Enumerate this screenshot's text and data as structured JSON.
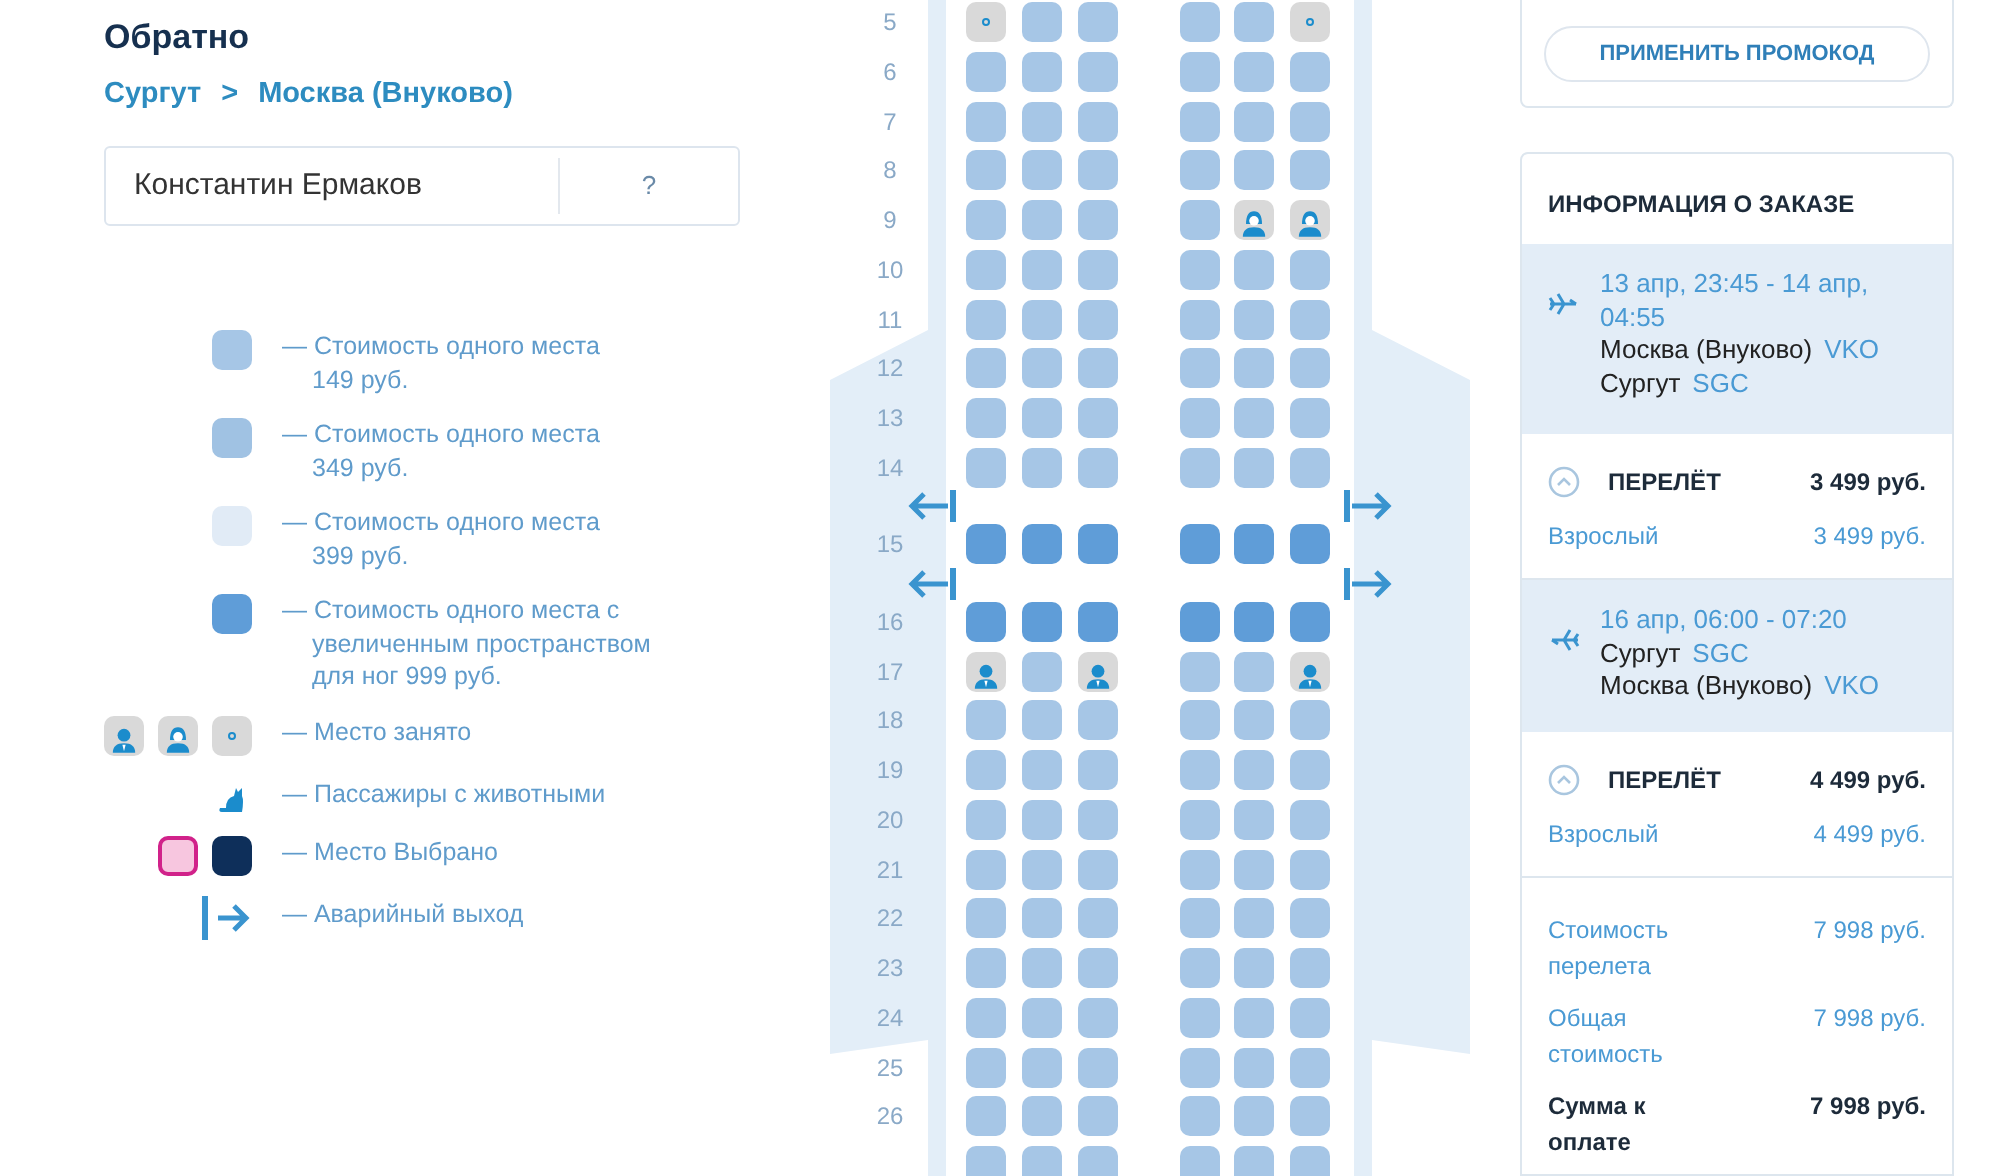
{
  "header": {
    "title": "Обратно",
    "route_from": "Сургут",
    "route_separator": ">",
    "route_to": "Москва (Внуково)"
  },
  "passenger": {
    "name": "Константин Ермаков",
    "help": "?"
  },
  "legend": [
    {
      "kind": "price",
      "color": "#a6c6e6",
      "text": "— Стоимость одного места\n149 руб."
    },
    {
      "kind": "price",
      "color": "#a0c2e3",
      "text": "— Стоимость одного места\n349 руб."
    },
    {
      "kind": "price",
      "color": "#e1ebf6",
      "text": "— Стоимость одного места\n399 руб."
    },
    {
      "kind": "price",
      "color": "#5f9dd8",
      "text": "— Стоимость одного места с\nувеличенным пространством\nдля ног 999 руб."
    },
    {
      "kind": "occupied",
      "icons": [
        {
          "kind": "male"
        },
        {
          "kind": "female"
        },
        {
          "kind": "dot"
        }
      ],
      "text": "— Место занято"
    },
    {
      "kind": "pets",
      "text": "— Пассажиры с животными"
    },
    {
      "kind": "selected",
      "text": "— Место Выбрано"
    },
    {
      "kind": "exit",
      "text": "— Аварийный выход"
    }
  ],
  "seat_map": {
    "rows": [
      {
        "number": "5",
        "exit": false,
        "seats": [
          {
            "kind": "dot"
          },
          {
            "kind": "std"
          },
          {
            "kind": "std"
          },
          {
            "kind": "std"
          },
          {
            "kind": "std"
          },
          {
            "kind": "dot"
          }
        ]
      },
      {
        "number": "6",
        "exit": false,
        "seats": [
          {
            "kind": "std"
          },
          {
            "kind": "std"
          },
          {
            "kind": "std"
          },
          {
            "kind": "std"
          },
          {
            "kind": "std"
          },
          {
            "kind": "std"
          }
        ]
      },
      {
        "number": "7",
        "exit": false,
        "seats": [
          {
            "kind": "std"
          },
          {
            "kind": "std"
          },
          {
            "kind": "std"
          },
          {
            "kind": "std"
          },
          {
            "kind": "std"
          },
          {
            "kind": "std"
          }
        ]
      },
      {
        "number": "8",
        "exit": false,
        "seats": [
          {
            "kind": "std"
          },
          {
            "kind": "std"
          },
          {
            "kind": "std"
          },
          {
            "kind": "std"
          },
          {
            "kind": "std"
          },
          {
            "kind": "std"
          }
        ]
      },
      {
        "number": "9",
        "exit": false,
        "seats": [
          {
            "kind": "std"
          },
          {
            "kind": "std"
          },
          {
            "kind": "std"
          },
          {
            "kind": "std"
          },
          {
            "kind": "female"
          },
          {
            "kind": "female"
          }
        ]
      },
      {
        "number": "10",
        "exit": false,
        "seats": [
          {
            "kind": "std"
          },
          {
            "kind": "std"
          },
          {
            "kind": "std"
          },
          {
            "kind": "std"
          },
          {
            "kind": "std"
          },
          {
            "kind": "std"
          }
        ]
      },
      {
        "number": "11",
        "exit": false,
        "seats": [
          {
            "kind": "std"
          },
          {
            "kind": "std"
          },
          {
            "kind": "std"
          },
          {
            "kind": "std"
          },
          {
            "kind": "std"
          },
          {
            "kind": "std"
          }
        ]
      },
      {
        "number": "12",
        "exit": false,
        "seats": [
          {
            "kind": "std"
          },
          {
            "kind": "std"
          },
          {
            "kind": "std"
          },
          {
            "kind": "std"
          },
          {
            "kind": "std"
          },
          {
            "kind": "std"
          }
        ]
      },
      {
        "number": "13",
        "exit": false,
        "seats": [
          {
            "kind": "std"
          },
          {
            "kind": "std"
          },
          {
            "kind": "std"
          },
          {
            "kind": "std"
          },
          {
            "kind": "std"
          },
          {
            "kind": "std"
          }
        ]
      },
      {
        "number": "14",
        "exit": false,
        "seats": [
          {
            "kind": "std"
          },
          {
            "kind": "std"
          },
          {
            "kind": "std"
          },
          {
            "kind": "std"
          },
          {
            "kind": "std"
          },
          {
            "kind": "std"
          }
        ]
      },
      {
        "number": "15",
        "exit": true,
        "seats": [
          {
            "kind": "extra"
          },
          {
            "kind": "extra"
          },
          {
            "kind": "extra"
          },
          {
            "kind": "extra"
          },
          {
            "kind": "extra"
          },
          {
            "kind": "extra"
          }
        ]
      },
      {
        "number": "16",
        "exit": true,
        "seats": [
          {
            "kind": "extra"
          },
          {
            "kind": "extra"
          },
          {
            "kind": "extra"
          },
          {
            "kind": "extra"
          },
          {
            "kind": "extra"
          },
          {
            "kind": "extra"
          }
        ]
      },
      {
        "number": "17",
        "exit": false,
        "seats": [
          {
            "kind": "male"
          },
          {
            "kind": "std"
          },
          {
            "kind": "male"
          },
          {
            "kind": "std"
          },
          {
            "kind": "std"
          },
          {
            "kind": "male"
          }
        ]
      },
      {
        "number": "18",
        "exit": false,
        "seats": [
          {
            "kind": "std"
          },
          {
            "kind": "std"
          },
          {
            "kind": "std"
          },
          {
            "kind": "std"
          },
          {
            "kind": "std"
          },
          {
            "kind": "std"
          }
        ]
      },
      {
        "number": "19",
        "exit": false,
        "seats": [
          {
            "kind": "std"
          },
          {
            "kind": "std"
          },
          {
            "kind": "std"
          },
          {
            "kind": "std"
          },
          {
            "kind": "std"
          },
          {
            "kind": "std"
          }
        ]
      },
      {
        "number": "20",
        "exit": false,
        "seats": [
          {
            "kind": "std"
          },
          {
            "kind": "std"
          },
          {
            "kind": "std"
          },
          {
            "kind": "std"
          },
          {
            "kind": "std"
          },
          {
            "kind": "std"
          }
        ]
      },
      {
        "number": "21",
        "exit": false,
        "seats": [
          {
            "kind": "std"
          },
          {
            "kind": "std"
          },
          {
            "kind": "std"
          },
          {
            "kind": "std"
          },
          {
            "kind": "std"
          },
          {
            "kind": "std"
          }
        ]
      },
      {
        "number": "22",
        "exit": false,
        "seats": [
          {
            "kind": "std"
          },
          {
            "kind": "std"
          },
          {
            "kind": "std"
          },
          {
            "kind": "std"
          },
          {
            "kind": "std"
          },
          {
            "kind": "std"
          }
        ]
      },
      {
        "number": "23",
        "exit": false,
        "seats": [
          {
            "kind": "std"
          },
          {
            "kind": "std"
          },
          {
            "kind": "std"
          },
          {
            "kind": "std"
          },
          {
            "kind": "std"
          },
          {
            "kind": "std"
          }
        ]
      },
      {
        "number": "24",
        "exit": false,
        "seats": [
          {
            "kind": "std"
          },
          {
            "kind": "std"
          },
          {
            "kind": "std"
          },
          {
            "kind": "std"
          },
          {
            "kind": "std"
          },
          {
            "kind": "std"
          }
        ]
      },
      {
        "number": "25",
        "exit": false,
        "seats": [
          {
            "kind": "std"
          },
          {
            "kind": "std"
          },
          {
            "kind": "std"
          },
          {
            "kind": "std"
          },
          {
            "kind": "std"
          },
          {
            "kind": "std"
          }
        ]
      },
      {
        "number": "26",
        "exit": false,
        "seats": [
          {
            "kind": "std"
          },
          {
            "kind": "std"
          },
          {
            "kind": "std"
          },
          {
            "kind": "std"
          },
          {
            "kind": "std"
          },
          {
            "kind": "std"
          }
        ]
      },
      {
        "exit": false,
        "seats": [
          {
            "kind": "std"
          },
          {
            "kind": "std"
          },
          {
            "kind": "std"
          },
          {
            "kind": "std"
          },
          {
            "kind": "std"
          },
          {
            "kind": "std"
          }
        ]
      }
    ]
  },
  "promo": {
    "button": "ПРИМЕНИТЬ ПРОМОКОД"
  },
  "order": {
    "title": "ИНФОРМАЦИЯ О ЗАКАЗЕ",
    "flights": [
      {
        "kind": "outbound",
        "time": "13 апр, 23:45 - 14 апр, 04:55",
        "from_city": "Москва (Внуково)",
        "from_code": "VKO",
        "to_city": "Сургут",
        "to_code": "SGC",
        "fare_label": "ПЕРЕЛЁТ",
        "fare_total": "3 499 руб.",
        "expanded": true,
        "passenger_type": "Взрослый",
        "passenger_price": "3 499 руб."
      },
      {
        "kind": "return",
        "time": "16 апр, 06:00 - 07:20",
        "from_city": "Сургут",
        "from_code": "SGC",
        "to_city": "Москва (Внуково)",
        "to_code": "VKO",
        "fare_label": "ПЕРЕЛЁТ",
        "fare_total": "4 499 руб.",
        "expanded": true,
        "passenger_type": "Взрослый",
        "passenger_price": "4 499 руб."
      }
    ],
    "totals": [
      {
        "kind": "normal",
        "label": "Стоимость перелета",
        "value": "7 998 руб."
      },
      {
        "kind": "normal",
        "label": "Общая стоимость",
        "value": "7 998 руб."
      },
      {
        "kind": "due",
        "label": "Сумма к оплате",
        "value": "7 998 руб."
      }
    ]
  }
}
